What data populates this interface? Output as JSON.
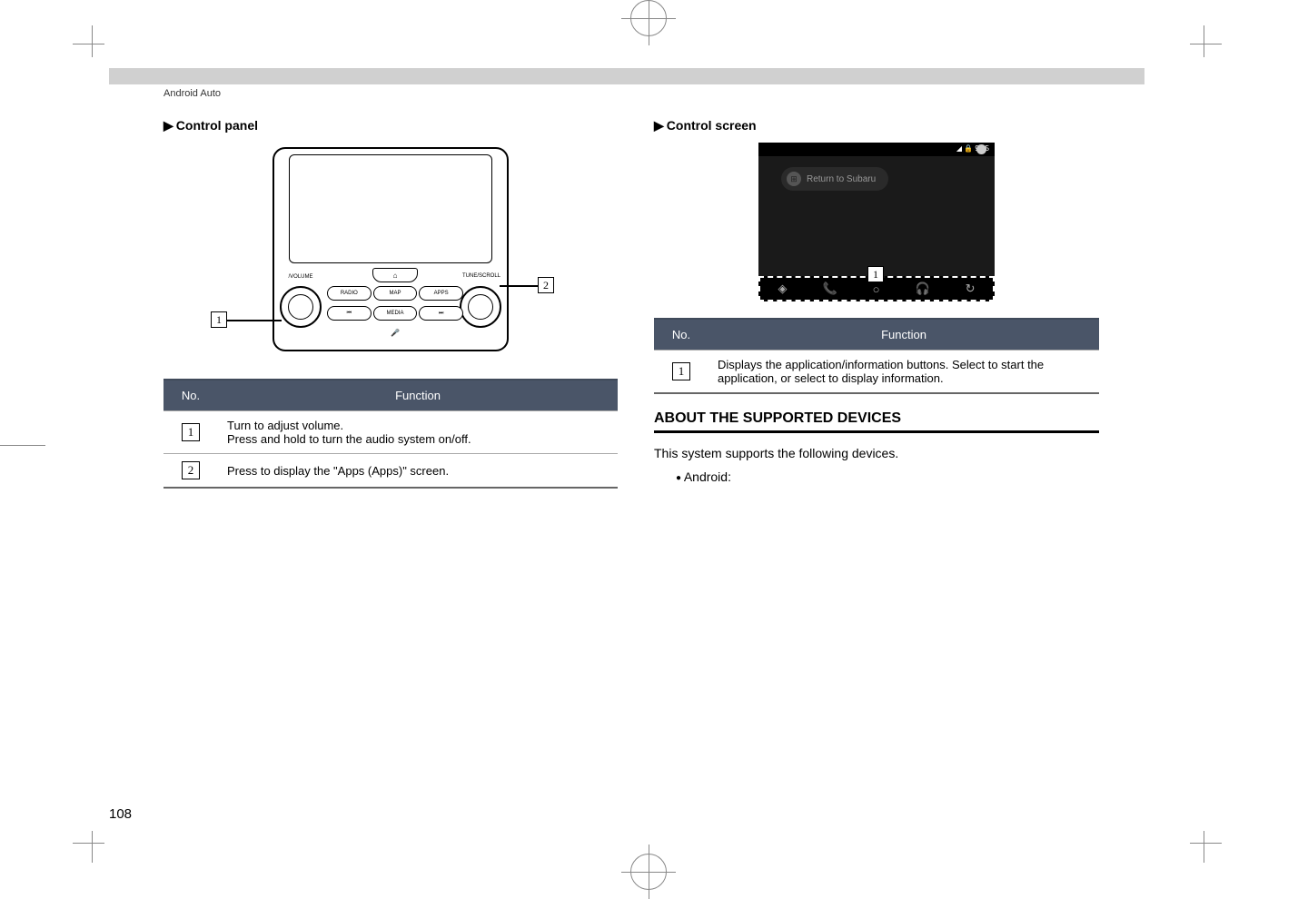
{
  "header": {
    "breadcrumb": "Android Auto"
  },
  "left": {
    "section_title": "Control panel",
    "panel_buttons": {
      "home": "⌂",
      "tune": "TUNE/SCROLL",
      "volume": "/VOLUME",
      "radio": "RADIO",
      "map": "MAP",
      "apps": "APPS",
      "prev": "⏮",
      "media": "MEDIA",
      "next": "⏭",
      "mic": "🎤"
    },
    "callout1": "1",
    "callout2": "2",
    "table": {
      "col_no": "No.",
      "col_func": "Function",
      "rows": [
        {
          "num": "1",
          "desc_line1": "Turn to adjust volume.",
          "desc_line2": "Press and hold to turn the audio system on/off."
        },
        {
          "num": "2",
          "desc_line1": "Press to display the \"Apps (Apps)\" screen.",
          "desc_line2": ""
        }
      ]
    }
  },
  "right": {
    "section_title": "Control screen",
    "screenshot": {
      "status_text": "◢ 🔒 9:35",
      "chip_label": "Return to Subaru",
      "nav_icons": {
        "maps": "◈",
        "phone": "📞",
        "home": "○",
        "music": "🎧",
        "recent": "↻"
      },
      "callout1": "1"
    },
    "table": {
      "col_no": "No.",
      "col_func": "Function",
      "rows": [
        {
          "num": "1",
          "desc": "Displays the application/information buttons. Select to start the application, or select to display information."
        }
      ]
    },
    "h2_devices": "ABOUT THE SUPPORTED DEVICES",
    "body1": "This system supports the following devices.",
    "bullet1": "Android:"
  },
  "page_number": "108"
}
